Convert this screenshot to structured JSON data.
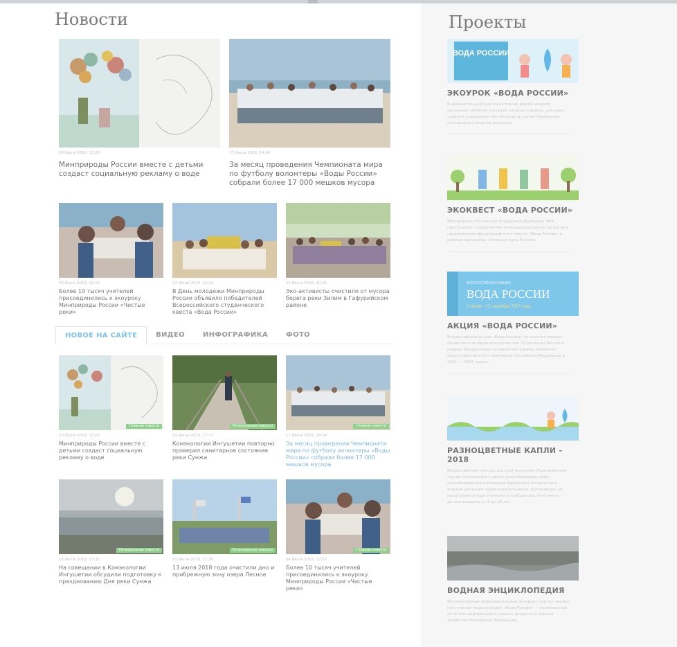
{
  "news": {
    "title": "Новости",
    "featured": [
      {
        "date": "20 Июля 2018, 12:00",
        "title": "Минприроды России вместе с детьми создаст социальную рекламу о воде"
      },
      {
        "date": "17 Июля 2018, 14:04",
        "title": "За месяц проведения Чемпионата мира по футболу волонтеры «Воды России» собрали более 17 000 мешков мусора"
      }
    ],
    "secondary": [
      {
        "date": "04 Июля 2018, 12:52",
        "title": "Более 10 тысяч учителей присоединились к экоуроку Минприроды России «Чистые реки»"
      },
      {
        "date": "27 Июня 2018, 10:22",
        "title": "В День молодежи Минприроды России объявило победителей Всероссийского студенческого квеста «Вода России»"
      },
      {
        "date": "15 Июня 2018, 10:21",
        "title": "Эко-активисты очистили от мусора берега реки Зилим в Гафурийском районе"
      }
    ]
  },
  "tabs": [
    "НОВОЕ НА САЙТЕ",
    "ВИДЕО",
    "ИНФОГРАФИКА",
    "ФОТО"
  ],
  "latest": [
    {
      "date": "20 Июля 2018, 12:00",
      "tag": "Главные новости",
      "title": "Минприроды России вместе с детьми создаст социальную рекламу о воде"
    },
    {
      "date": "19 Июля 2018, 17:37",
      "tag": "Региональные новости",
      "title": "Комэкологии Ингушетии повторно проверил санитарное состояние реки Сунжа"
    },
    {
      "date": "17 Июля 2018, 14:04",
      "tag": "Главные новости",
      "title": "За месяц проведения Чемпионата мира по футболу волонтеры «Воды России» собрали более 17 000 мешков мусора"
    },
    {
      "date": "16 Июля 2018, 17:21",
      "tag": "Региональные новости",
      "title": "На совещании в Комэкологии Ингушетии обсудили подготовку к празднованию Дня реки Сунжа"
    },
    {
      "date": "13 Июля 2018, 17:30",
      "tag": "Региональные новости",
      "title": "13 июля 2018 года очистили дно и прибрежную зону озера Лесное"
    },
    {
      "date": "04 Июля 2018, 12:52",
      "tag": "Главные новости",
      "title": "Более 10 тысяч учителей присоединились к экоуроку Минприроды России «Чистые реки»"
    }
  ],
  "projects": {
    "title": "Проекты",
    "items": [
      {
        "name": "ЭКОУРОК «ВОДА РОССИИ»",
        "banner_text": "ВОДА РОССИИ",
        "desc": "В увлекательной и интерактивной форме экоурок расскажет ребятам о водных запасах планеты, раскроет секреты сохранения чистой воды и научит бережному отношению к водным ресурсам."
      },
      {
        "name": "ЭКОКВЕСТ «ВОДА РОССИИ»",
        "desc": "Минприроды России при поддержке Движения ЭКА приглашают студенческие команды российских вузов для прохождения общероссийского квеста «Вода России» в рамках программы «Зеленые вузы России»"
      },
      {
        "name": "АКЦИЯ «ВОДА РОССИИ»",
        "banner_small": "ВСЕРОССИЙСКАЯ АКЦИЯ",
        "banner_text": "ВОДА РОССИИ",
        "banner_dates": "1 июня - 15 сентября 2017 года",
        "desc": "Всероссийская акция «Вода России» по очистке водных объектов и их берегов в более чем 70 регионах России в рамках Федеральной целевой программы «Развитие водохозяйственного комплекса Российской Федерации в 2012 — 2020 годах»"
      },
      {
        "name": "РАЗНОЦВЕТНЫЕ КАПЛИ – 2018",
        "desc": "Всероссийский конкурс детских рисунков «Разноцветные капли» проводится с целью популяризации идей водосбережения и развития бережного отношения к водным ресурсам среди дошкольников, школьников, их родителей и педагогического сообщества. Участники – дети в возрасте от 3 до 16 лет."
      },
      {
        "name": "ВОДНАЯ ЭНЦИКЛОПЕДИЯ",
        "desc": "Интерактивный образовательный интернет-портал научно-популярная энциклопедия «Вода России» — комплексный источник информации о водных ресурсах и водном хозяйстве Российской Федерации"
      }
    ]
  }
}
